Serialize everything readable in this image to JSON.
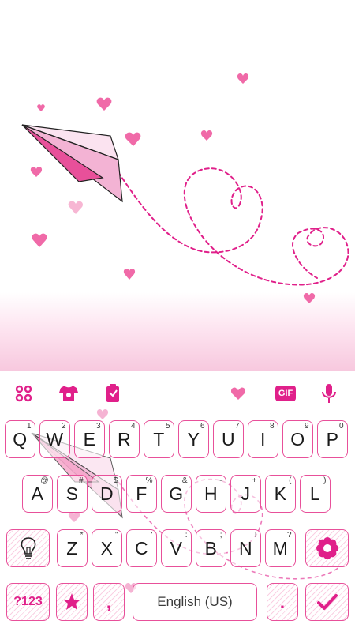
{
  "toolbar": {
    "gif_label": "GIF",
    "icons": [
      "apps-icon",
      "theme-shirt-icon",
      "sticker-icon",
      "heart-icon",
      "gif-icon",
      "microphone-icon"
    ]
  },
  "keyboard": {
    "row1": [
      {
        "label": "Q",
        "hint": "1"
      },
      {
        "label": "W",
        "hint": "2"
      },
      {
        "label": "E",
        "hint": "3"
      },
      {
        "label": "R",
        "hint": "4"
      },
      {
        "label": "T",
        "hint": "5"
      },
      {
        "label": "Y",
        "hint": "6"
      },
      {
        "label": "U",
        "hint": "7"
      },
      {
        "label": "I",
        "hint": "8"
      },
      {
        "label": "O",
        "hint": "9"
      },
      {
        "label": "P",
        "hint": "0"
      }
    ],
    "row2": [
      {
        "label": "A",
        "hint": "@"
      },
      {
        "label": "S",
        "hint": "#"
      },
      {
        "label": "D",
        "hint": "$"
      },
      {
        "label": "F",
        "hint": "%"
      },
      {
        "label": "G",
        "hint": "&"
      },
      {
        "label": "H",
        "hint": "-"
      },
      {
        "label": "J",
        "hint": "+"
      },
      {
        "label": "K",
        "hint": "("
      },
      {
        "label": "L",
        "hint": ")"
      }
    ],
    "row3": [
      {
        "label": "Z",
        "hint": "*"
      },
      {
        "label": "X",
        "hint": "\""
      },
      {
        "label": "C",
        "hint": "'"
      },
      {
        "label": "V",
        "hint": ":"
      },
      {
        "label": "B",
        "hint": ";"
      },
      {
        "label": "N",
        "hint": "!"
      },
      {
        "label": "M",
        "hint": "?"
      }
    ],
    "symbols_label": "?123",
    "comma_label": ",",
    "space_label": "English (US)",
    "period_label": "."
  },
  "colors": {
    "accent": "#e0208a",
    "key_border": "#e8509a",
    "heart": "#f06aa8",
    "plane": "#f3b3d4"
  }
}
